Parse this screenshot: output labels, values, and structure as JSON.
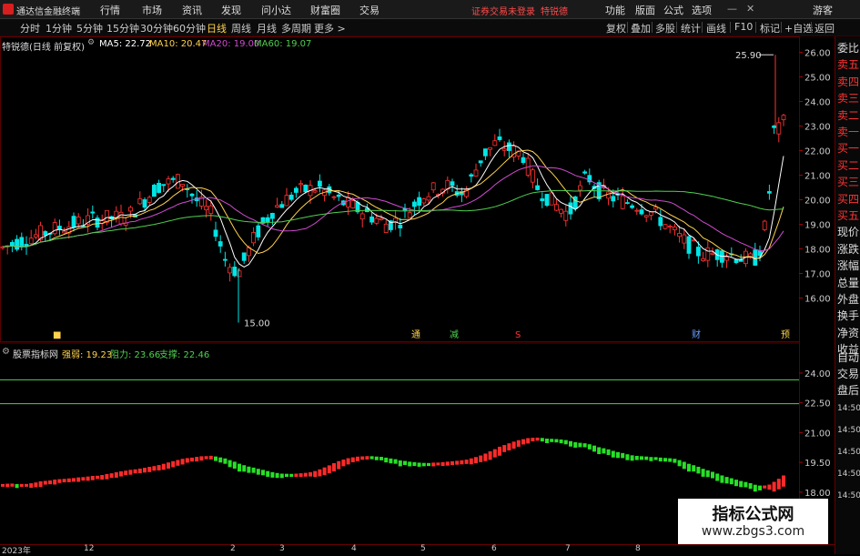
{
  "app": {
    "title": "通达信金融终端",
    "login_notice": "证券交易未登录",
    "login_user": "特锐德"
  },
  "menu": [
    "行情",
    "市场",
    "资讯",
    "发现",
    "问小达",
    "财富圈",
    "交易"
  ],
  "right_menu": [
    "功能",
    "版面",
    "公式",
    "选项",
    "游客"
  ],
  "timeframes": [
    "分时",
    "1分钟",
    "5分钟",
    "15分钟",
    "30分钟",
    "60分钟",
    "日线",
    "周线",
    "月线",
    "多周期",
    "更多 >"
  ],
  "active_timeframe": "日线",
  "toolbar_right": [
    "复权",
    "叠加",
    "多股",
    "统计",
    "画线",
    "F10",
    "标记",
    "+自选",
    "返回"
  ],
  "main_panel": {
    "stock_label": "特锐德(日线 前复权)",
    "ma": [
      {
        "label": "MA5: 22.72",
        "color": "#ffffff"
      },
      {
        "label": "MA10: 20.47",
        "color": "#ffd24d"
      },
      {
        "label": "MA20: 19.00",
        "color": "#d04bd0"
      },
      {
        "label": "MA60: 19.07",
        "color": "#4fd04f"
      }
    ],
    "high_label": "25.90",
    "low_label": "15.00",
    "price_ticks": [
      "26.00",
      "25.00",
      "24.00",
      "23.00",
      "22.00",
      "21.00",
      "20.00",
      "19.00",
      "18.00",
      "17.00",
      "16.00"
    ],
    "markers": [
      "通",
      "减",
      "S",
      "财",
      "预"
    ]
  },
  "indicator_panel": {
    "name": "股票指标网",
    "line_label": "强弱: 19.23",
    "resistance_label": "阻力: 23.66",
    "support_label": "支撑: 22.46",
    "ticks": [
      "24.00",
      "22.50",
      "21.00",
      "19.50",
      "18.00"
    ]
  },
  "sidebar": {
    "items": [
      "委比",
      "卖五",
      "卖四",
      "卖三",
      "卖二",
      "卖一",
      "买一",
      "买二",
      "买三",
      "买四",
      "买五",
      "现价",
      "涨跌",
      "涨幅",
      "总量",
      "外盘",
      "换手",
      "净资",
      "收益"
    ],
    "items2": [
      "自动",
      "交易",
      "盘后"
    ],
    "times": [
      "14:50",
      "14:50",
      "14:50",
      "14:50",
      "14:50"
    ]
  },
  "time_axis": [
    "2023年",
    "12",
    "2",
    "3",
    "4",
    "5",
    "6",
    "7",
    "8"
  ],
  "watermark": {
    "title": "指标公式网",
    "url": "www.zbgs3.com"
  },
  "colors": {
    "up": "#ff3232",
    "down": "#00e5e5",
    "ma5": "#ffffff",
    "ma10": "#ffd24d",
    "ma20": "#d04bd0",
    "ma60": "#4fd04f",
    "grid": "#5a0000",
    "strong": "#ff2a2a",
    "weak": "#26e026"
  }
}
